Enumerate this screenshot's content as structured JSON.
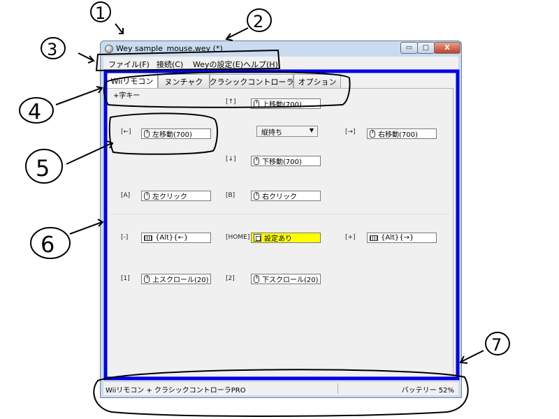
{
  "window": {
    "title": "Wey sample_mouse.wey (*)",
    "controls": {
      "minimize": "▭",
      "maximize": "□",
      "close": "X"
    }
  },
  "menu": [
    "ファイル(F)",
    "接続(C)",
    "Weyの設定(E)",
    "ヘルプ(H)"
  ],
  "tabs": [
    "Wiiリモコン",
    "ヌンチャク",
    "クラシックコントローラ",
    "オプション"
  ],
  "active_tab": 0,
  "group_header": "+字キー",
  "dpad": {
    "up": {
      "label": "[↑]",
      "value": "上移動(700)"
    },
    "left": {
      "label": "[←]",
      "value": "左移動(700)"
    },
    "right": {
      "label": "[→]",
      "value": "右移動(700)"
    },
    "down": {
      "label": "[↓]",
      "value": "下移動(700)"
    },
    "orientation": "縦持ち"
  },
  "buttons": {
    "a": {
      "label": "[A]",
      "value": "左クリック",
      "icon": "mouse-icon"
    },
    "b": {
      "label": "[B]",
      "value": "右クリック",
      "icon": "mouse-icon"
    },
    "minus": {
      "label": "[-]",
      "value": "{Alt}{←}",
      "icon": "keyboard-icon"
    },
    "home": {
      "label": "[HOME]",
      "value": "設定あり",
      "icon": "settings-icon",
      "highlight": "#ffff00"
    },
    "plus": {
      "label": "[+]",
      "value": "{Alt}{→}",
      "icon": "keyboard-icon"
    },
    "one": {
      "label": "[1]",
      "value": "上スクロール(20)",
      "icon": "mouse-icon"
    },
    "two": {
      "label": "[2]",
      "value": "下スクロール(20)",
      "icon": "mouse-icon"
    }
  },
  "status": {
    "left": "Wiiリモコン + クラシックコントローラPRO",
    "right": "バッテリー 52%"
  },
  "annotations": [
    "1",
    "2",
    "3",
    "4",
    "5",
    "6",
    "7"
  ],
  "colors": {
    "highlight_frame": "#0000ee",
    "home_fill": "#ffff00",
    "title_bg": "#c9dbef"
  }
}
